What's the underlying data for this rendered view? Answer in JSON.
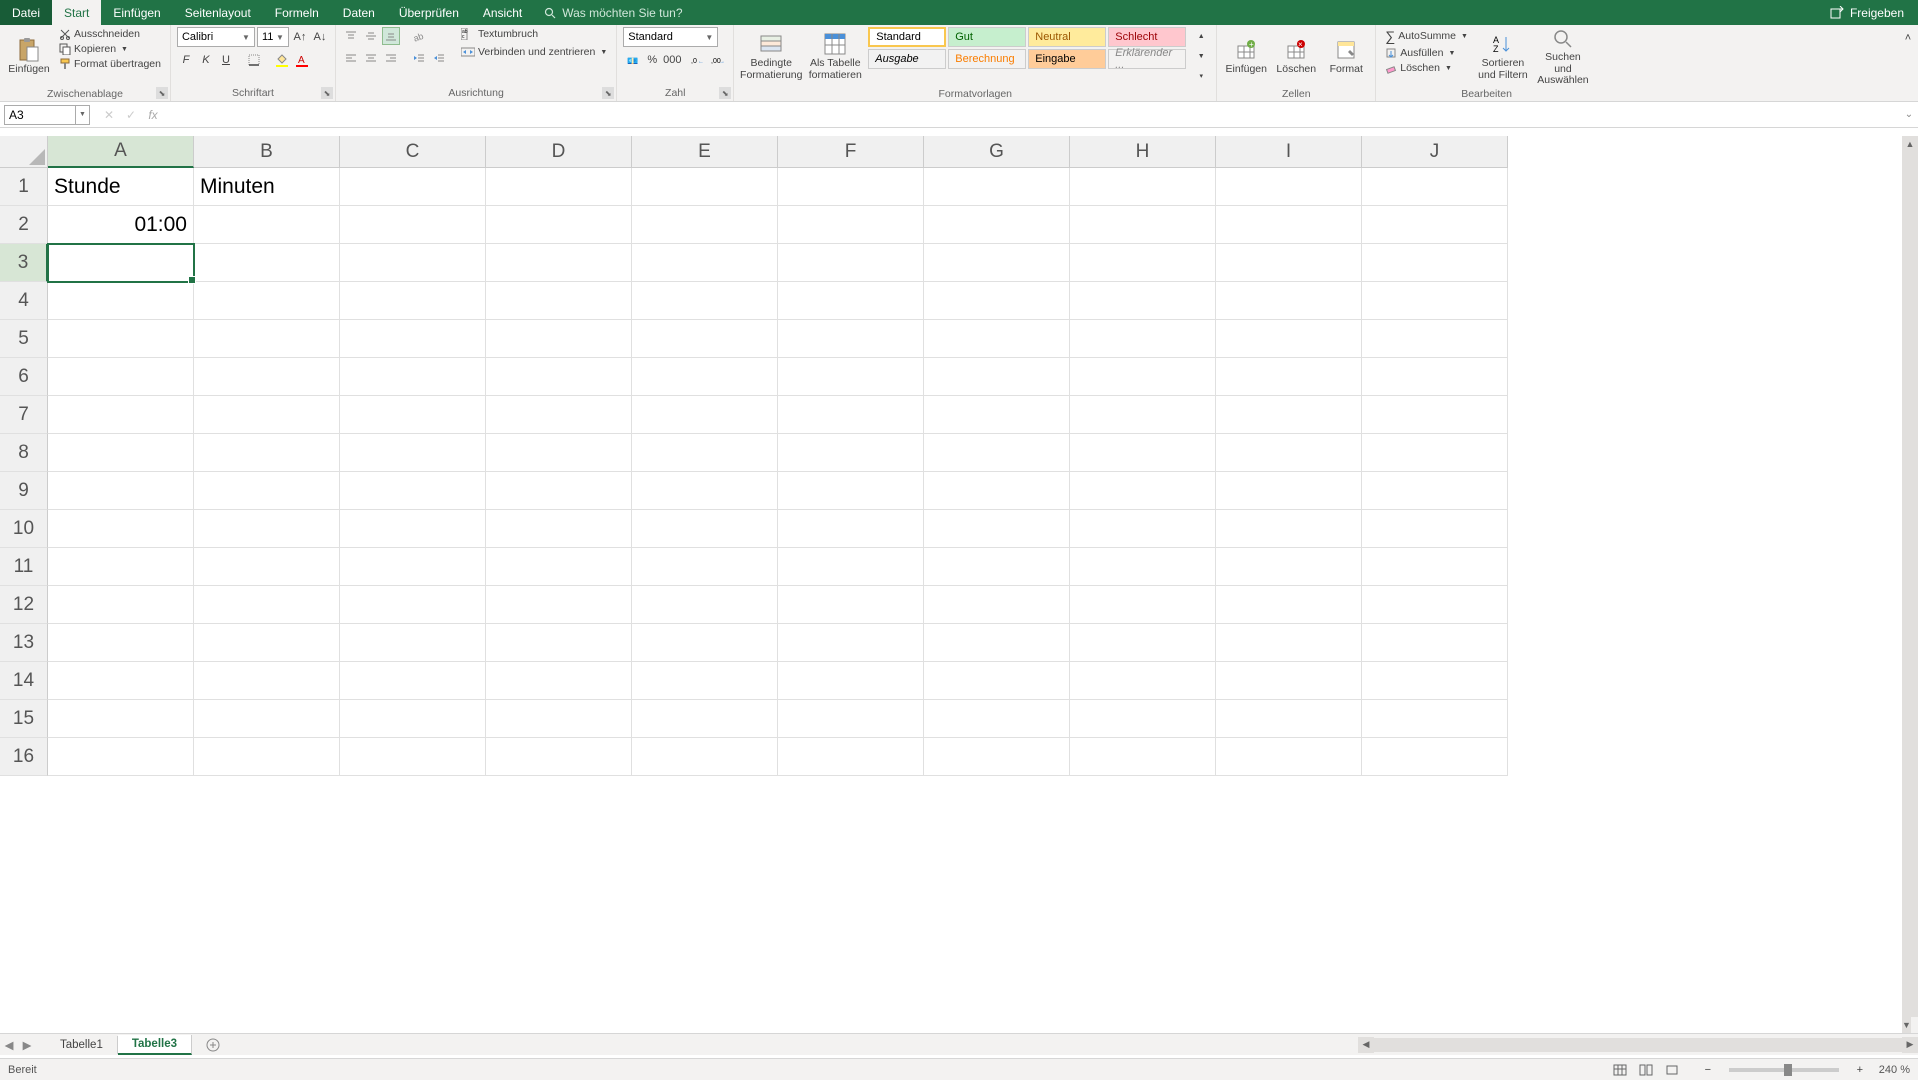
{
  "menu": {
    "file": "Datei",
    "tabs": [
      "Start",
      "Einfügen",
      "Seitenlayout",
      "Formeln",
      "Daten",
      "Überprüfen",
      "Ansicht"
    ],
    "active_tab": "Start",
    "tell_me": "Was möchten Sie tun?",
    "share": "Freigeben"
  },
  "ribbon": {
    "clipboard": {
      "paste": "Einfügen",
      "cut": "Ausschneiden",
      "copy": "Kopieren",
      "format_painter": "Format übertragen",
      "label": "Zwischenablage"
    },
    "font": {
      "name": "Calibri",
      "size": "11",
      "label": "Schriftart"
    },
    "alignment": {
      "wrap": "Textumbruch",
      "merge": "Verbinden und zentrieren",
      "label": "Ausrichtung"
    },
    "number": {
      "format": "Standard",
      "label": "Zahl"
    },
    "styles": {
      "cond": "Bedingte Formatierung",
      "table": "Als Tabelle formatieren",
      "s1": "Standard",
      "s2": "Gut",
      "s3": "Neutral",
      "s4": "Schlecht",
      "s5": "Ausgabe",
      "s6": "Berechnung",
      "s7": "Eingabe",
      "s8": "Erklärender ...",
      "label": "Formatvorlagen"
    },
    "cells": {
      "insert": "Einfügen",
      "delete": "Löschen",
      "format": "Format",
      "label": "Zellen"
    },
    "editing": {
      "autosum": "AutoSumme",
      "fill": "Ausfüllen",
      "clear": "Löschen",
      "sort": "Sortieren und Filtern",
      "find": "Suchen und Auswählen",
      "label": "Bearbeiten"
    }
  },
  "namebox": "A3",
  "formula": "",
  "columns": [
    "A",
    "B",
    "C",
    "D",
    "E",
    "F",
    "G",
    "H",
    "I",
    "J"
  ],
  "rows": [
    "1",
    "2",
    "3",
    "4",
    "5",
    "6",
    "7",
    "8",
    "9",
    "10",
    "11",
    "12",
    "13",
    "14",
    "15",
    "16"
  ],
  "cells": {
    "A1": "Stunde",
    "B1": "Minuten",
    "A2": "01:00"
  },
  "active_cell": "A3",
  "selected_col": "A",
  "selected_row": "3",
  "sheets": {
    "items": [
      "Tabelle1",
      "Tabelle3"
    ],
    "active": "Tabelle3"
  },
  "status": {
    "ready": "Bereit",
    "zoom": "240 %"
  }
}
